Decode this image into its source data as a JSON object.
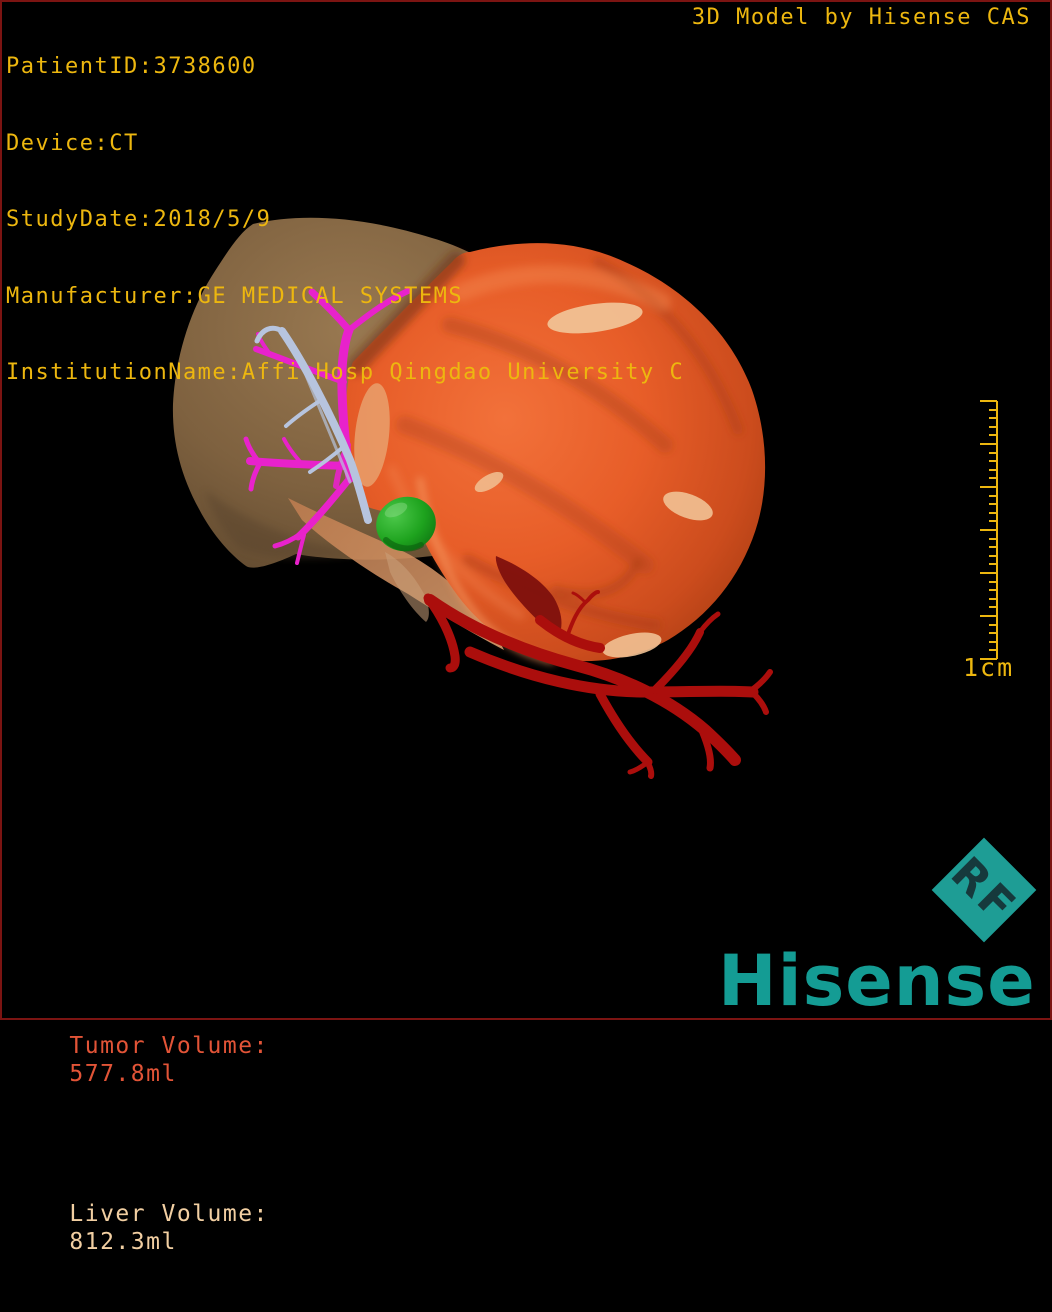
{
  "header": {
    "lines": [
      "PatientID:3738600",
      "Device:CT",
      "StudyDate:2018/5/9",
      "Manufacturer:GE MEDICAL SYSTEMS",
      "InstitutionName:Affi Hosp Qingdao University C"
    ],
    "title": "3D Model by Hisense CAS"
  },
  "footer": {
    "volumes": [
      {
        "name": "tumor",
        "label": "Tumor Volume:",
        "value": "577.8ml"
      },
      {
        "name": "liver",
        "label": "Liver Volume:",
        "value": "812.3ml"
      }
    ]
  },
  "ruler": {
    "label": "1cm",
    "major_ticks": 7,
    "minor_ticks_per_interval": 4
  },
  "branding": {
    "wordmark": "Hisense",
    "watermark": "RF"
  },
  "model": {
    "structures": [
      {
        "name": "liver",
        "color": "#8b6a47"
      },
      {
        "name": "tumor",
        "color": "#e55d28"
      },
      {
        "name": "portal-vein",
        "color": "#e822cb"
      },
      {
        "name": "hepatic-vein",
        "color": "#b7c4de"
      },
      {
        "name": "hepatic-artery",
        "color": "#ab0e0c"
      },
      {
        "name": "gallbladder",
        "color": "#24a824"
      }
    ]
  },
  "colors": {
    "accent_gold": "#edb70f",
    "tumor_text": "#e25437",
    "liver_text": "#f2cfa2",
    "brand_teal": "#149c94",
    "frame_red": "#7c1412",
    "background": "#000000",
    "portal_vein": "#e822cb",
    "hepatic_vein": "#b7c4de",
    "artery": "#ab0e0c",
    "gallbladder_green": "#24a824"
  }
}
